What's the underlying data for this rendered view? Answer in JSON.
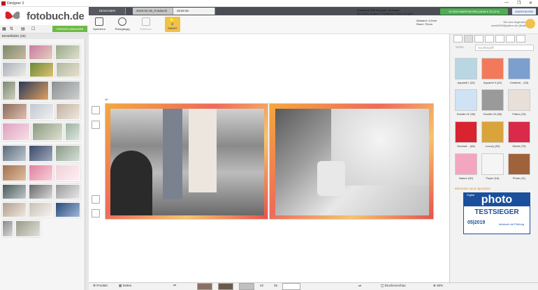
{
  "window": {
    "title": "Designer 3",
    "controls": [
      "—",
      "❐",
      "✕"
    ]
  },
  "brand": {
    "name": "fotobuch.de"
  },
  "tabs": {
    "designer": "DESIGNER",
    "doc1": "2019-02-26_Fotobuch",
    "doc2": "2019-03-20_Fotobuch_3"
  },
  "product": {
    "line1": "Fotobuch DIN A4 Quer, Schwarz",
    "line2": "26 Seiten, Amano™ seidiches Glanz 200g/m²"
  },
  "cart": {
    "button": "IN DEN WARENKORB (48,66 € 33,33 €)",
    "link": "WARENKORB"
  },
  "toolbar": {
    "save": "Speichern",
    "undo": "Rückgängig",
    "remove": "Entfernen",
    "smart": "SMART"
  },
  "margins": {
    "distance_label": "Abstand:",
    "distance_value": "4,0mm",
    "border_label": "Rand:",
    "border_value": "72mm"
  },
  "user": {
    "status": "Sie sind angemeldet als:",
    "email": "mark2009@yahoo.de",
    "logout": "(Ausloggen)"
  },
  "left": {
    "order_button": "ORDNER-MANAGER",
    "title": "Bestellbilder (29)"
  },
  "canvas": {
    "page_number": "#8"
  },
  "right": {
    "sort": "Sortie",
    "search_placeholder": "Suchbegriff",
    "categories": [
      {
        "label": "Aquarell I (33)",
        "color": "#b9d6e3"
      },
      {
        "label": "Aquarell II (42)",
        "color": "#f27a5a"
      },
      {
        "label": "Celebrat... (33)",
        "color": "#7b9fcf"
      },
      {
        "label": "Doodle 01 (96)",
        "color": "#cfe3f4"
      },
      {
        "label": "Doodle 02 (66)",
        "color": "#9a9a9a"
      },
      {
        "label": "Fabric (15)",
        "color": "#e8e0d8"
      },
      {
        "label": "Geomet... (66)",
        "color": "#d8242f"
      },
      {
        "label": "Luxury (45)",
        "color": "#d9a43a"
      },
      {
        "label": "Mixed (75)",
        "color": "#d92a4a"
      },
      {
        "label": "Nature (62)",
        "color": "#f4a5c0"
      },
      {
        "label": "Paper (16)",
        "color": "#f5f5f5"
      },
      {
        "label": "Photo (11)",
        "color": "#a0623b"
      }
    ],
    "more_link": "Elemente neue speichern",
    "badge": {
      "brand": "photo",
      "kicker": "Digital",
      "title": "TESTSIEGER",
      "date": "05|2019",
      "site": "fotobuch.de Prüfung"
    }
  },
  "bottom": {
    "product": "Produkt",
    "pages": "Seiten",
    "page_counter": "22",
    "page_total": "26",
    "print_preview": "Druckvorschau",
    "zoom": "48%"
  }
}
